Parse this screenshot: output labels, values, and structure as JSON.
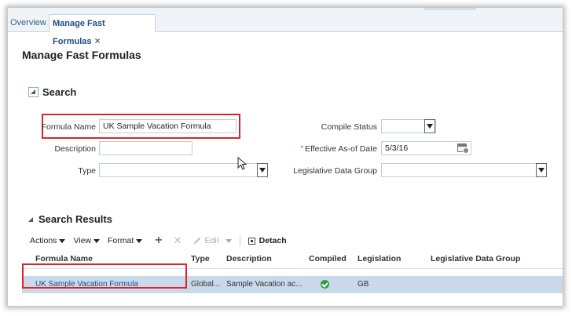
{
  "tabs": {
    "overview": "Overview",
    "active": "Manage Fast Formulas",
    "close": "×"
  },
  "page_title": "Manage Fast Formulas",
  "search": {
    "header": "Search",
    "formula_name_label": "Formula Name",
    "formula_name_value": "UK Sample Vacation Formula",
    "description_label": "Description",
    "description_value": "",
    "type_label": "Type",
    "type_value": "",
    "compile_status_label": "Compile Status",
    "compile_status_value": "",
    "effective_label": "Effective As-of Date",
    "effective_required": "*",
    "effective_value": "5/3/16",
    "legislative_label": "Legislative Data Group",
    "legislative_value": ""
  },
  "results": {
    "header": "Search Results",
    "toolbar": {
      "actions": "Actions",
      "view": "View",
      "format": "Format",
      "add": "+",
      "delete": "✕",
      "edit": "Edit",
      "detach": "Detach"
    },
    "columns": [
      "Formula Name",
      "Type",
      "Description",
      "Compiled",
      "Legislation",
      "Legislative Data Group"
    ],
    "rows": [
      {
        "formula_name": "UK Sample Vacation Formula",
        "type": "Global...",
        "description": "Sample Vacation ac...",
        "compiled": "check",
        "legislation": "GB",
        "legislative_data_group": ""
      }
    ]
  },
  "colors": {
    "highlight": "#d8252b",
    "link": "#1d4f85",
    "selected_row": "#c9d9ea",
    "success": "#2f9c3e"
  }
}
